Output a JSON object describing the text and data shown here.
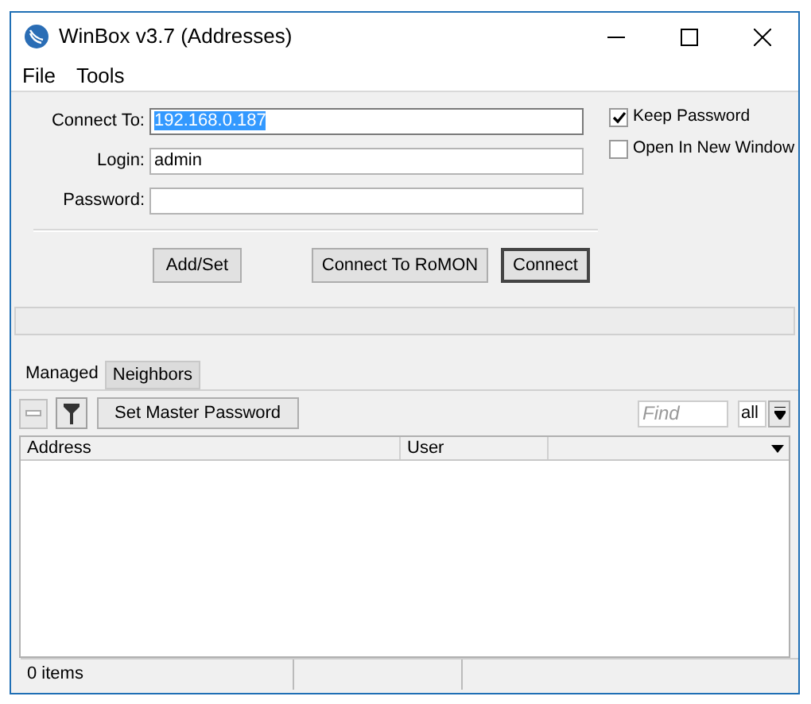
{
  "window": {
    "title": "WinBox v3.7 (Addresses)"
  },
  "menu": [
    "File",
    "Tools"
  ],
  "fields": [
    {
      "label": "Connect To:",
      "value": "192.168.0.187",
      "selected": true
    },
    {
      "label": "Login:",
      "value": "admin",
      "selected": false
    },
    {
      "label": "Password:",
      "selected": false
    }
  ],
  "options": [
    {
      "label": "Keep Password",
      "checked": true
    },
    {
      "label": "Open In New Window",
      "checked": false
    }
  ],
  "buttons": [
    {
      "label": "Add/Set",
      "default": false
    },
    {
      "label": "Connect To RoMON",
      "default": false
    },
    {
      "label": "Connect",
      "default": true
    }
  ],
  "tabs": [
    {
      "label": "Managed",
      "selected": true
    },
    {
      "label": "Neighbors",
      "selected": false
    }
  ],
  "toolbar": {
    "master_button": "Set Master Password",
    "find": {
      "placeholder": "Find"
    },
    "filter": "all"
  },
  "table": {
    "columns": [
      "Address",
      "User"
    ]
  },
  "status_bar": [
    "0 items"
  ]
}
